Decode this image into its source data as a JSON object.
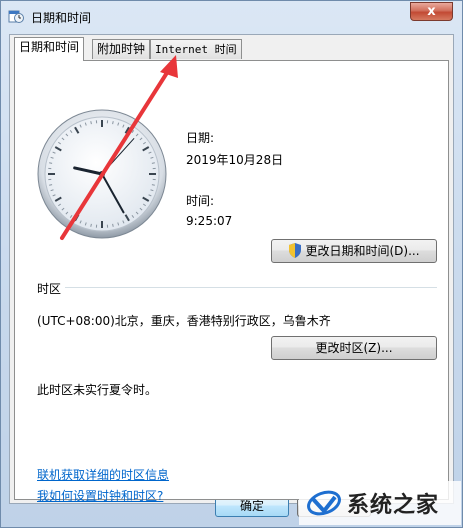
{
  "window": {
    "title": "日期和时间",
    "close_label": "x"
  },
  "tabs": [
    {
      "label": "日期和时间",
      "active": true
    },
    {
      "label": "附加时钟",
      "active": false
    },
    {
      "label": "Internet 时间",
      "active": false
    }
  ],
  "date_section": {
    "date_label": "日期:",
    "date_value": "2019年10月28日",
    "time_label": "时间:",
    "time_value": "9:25:07"
  },
  "buttons": {
    "change_datetime": "更改日期和时间(D)...",
    "change_timezone": "更改时区(Z)...",
    "ok": "确定"
  },
  "timezone": {
    "group_label": "时区",
    "value": "(UTC+08:00)北京，重庆，香港特别行政区，乌鲁木齐",
    "dst_note": "此时区未实行夏令时。"
  },
  "links": {
    "online_info": "联机获取详细的时区信息",
    "how_to": "我如何设置时钟和时区?"
  },
  "watermark": {
    "text": "系统之家"
  },
  "colors": {
    "link": "#0066cc",
    "arrow": "#e8363a",
    "close": "#c24a34"
  },
  "clock": {
    "hour": 9,
    "minute": 25,
    "second": 7
  }
}
